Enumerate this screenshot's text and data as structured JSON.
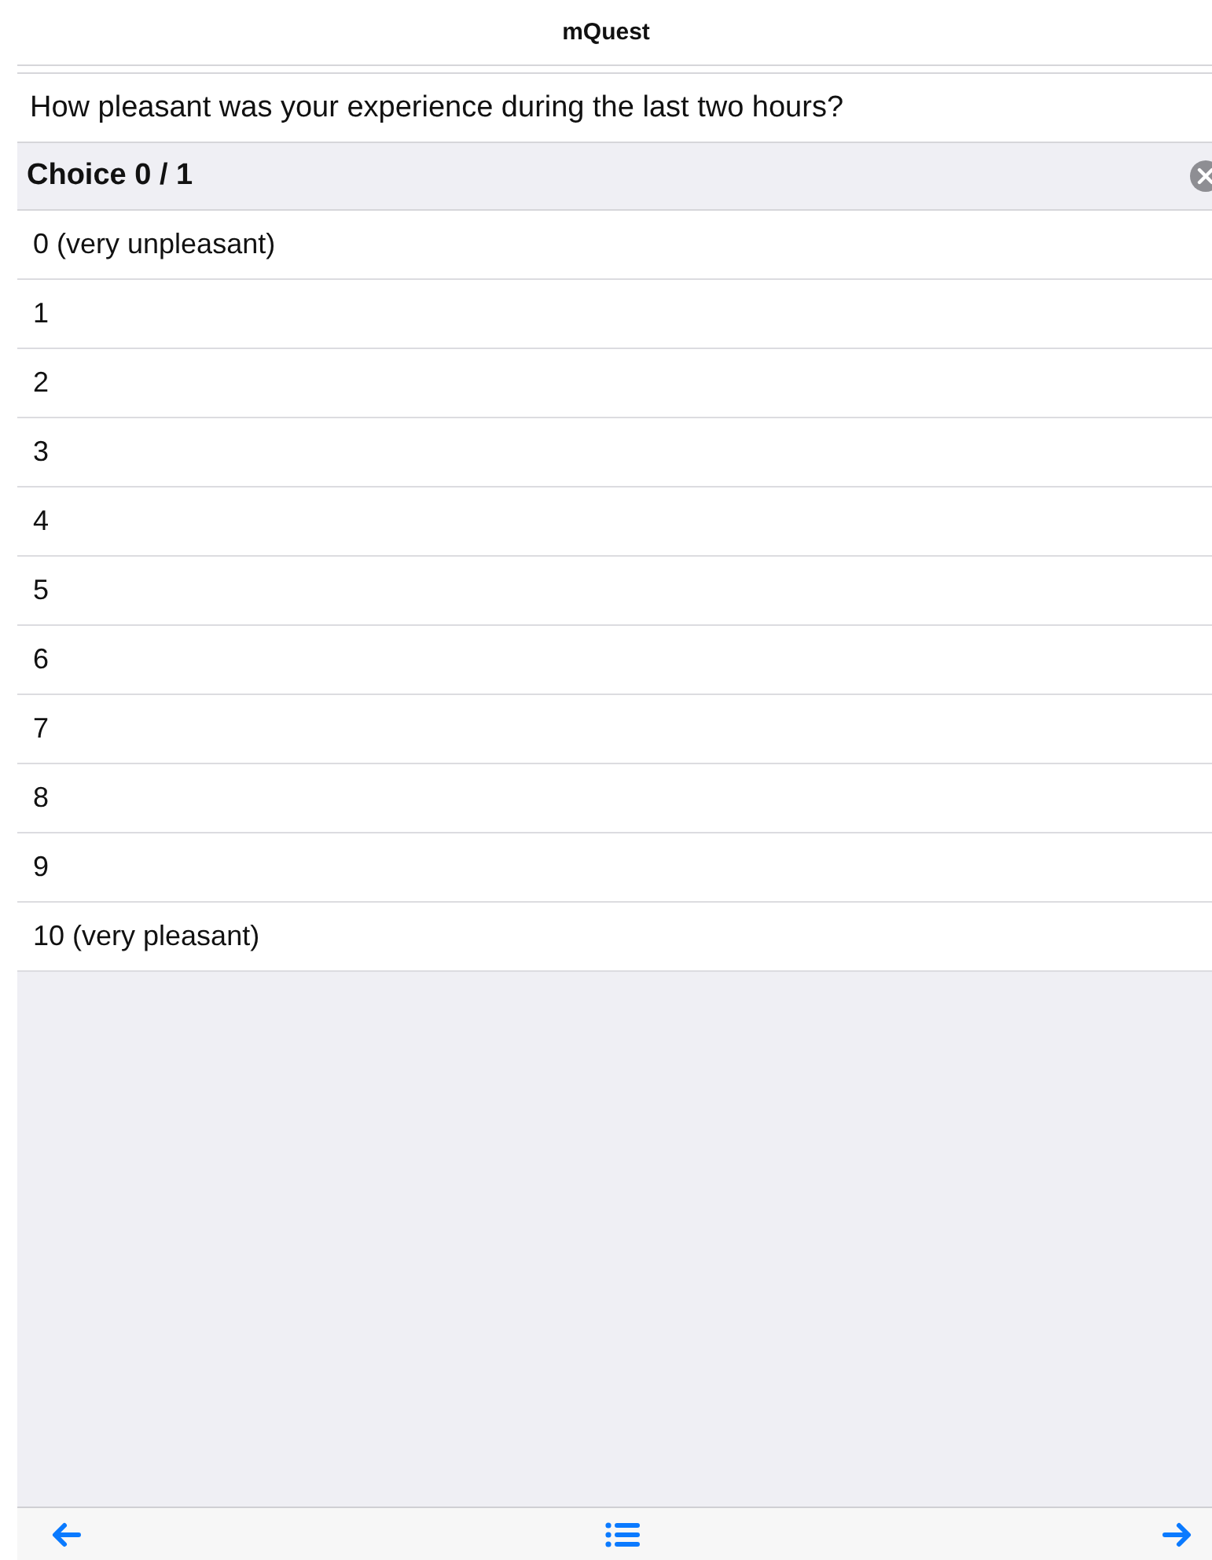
{
  "window": {
    "title": "mQuest"
  },
  "question": "How pleasant was your experience during the last two hours?",
  "choice_header": "Choice 0 / 1",
  "options": [
    {
      "label": "0 (very unpleasant)",
      "selected": false
    },
    {
      "label": "1",
      "selected": false
    },
    {
      "label": "2",
      "selected": false
    },
    {
      "label": "3",
      "selected": false
    },
    {
      "label": "4",
      "selected": false
    },
    {
      "label": "5",
      "selected": false
    },
    {
      "label": "6",
      "selected": false
    },
    {
      "label": "7",
      "selected": false
    },
    {
      "label": "8",
      "selected": false
    },
    {
      "label": "9",
      "selected": false
    },
    {
      "label": "10 (very pleasant)",
      "selected": false
    }
  ]
}
